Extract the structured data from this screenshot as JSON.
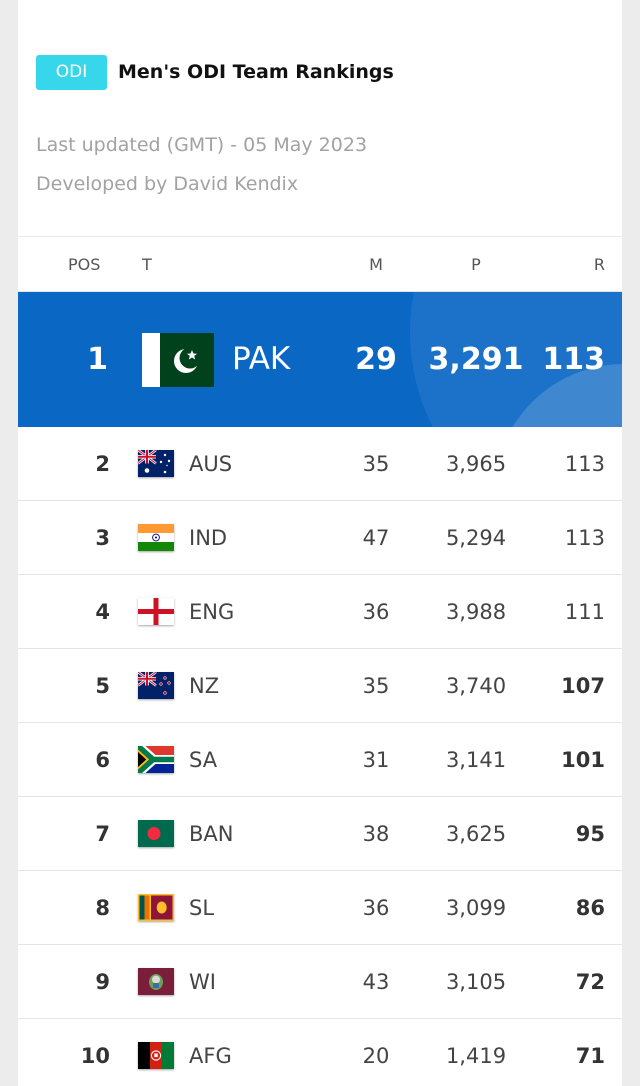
{
  "header": {
    "badge": "ODI",
    "title": "Men's ODI Team Rankings",
    "last_updated": "Last updated (GMT) - 05 May 2023",
    "developer": "Developed by David Kendix"
  },
  "columns": {
    "pos": "POS",
    "team": "T",
    "matches": "M",
    "points": "P",
    "rating": "R"
  },
  "rows": [
    {
      "pos": "1",
      "code": "PAK",
      "flag": "pakistan-flag-icon",
      "m": "29",
      "p": "3,291",
      "r": "113"
    },
    {
      "pos": "2",
      "code": "AUS",
      "flag": "australia-flag-icon",
      "m": "35",
      "p": "3,965",
      "r": "113"
    },
    {
      "pos": "3",
      "code": "IND",
      "flag": "india-flag-icon",
      "m": "47",
      "p": "5,294",
      "r": "113"
    },
    {
      "pos": "4",
      "code": "ENG",
      "flag": "england-flag-icon",
      "m": "36",
      "p": "3,988",
      "r": "111"
    },
    {
      "pos": "5",
      "code": "NZ",
      "flag": "new-zealand-flag-icon",
      "m": "35",
      "p": "3,740",
      "r": "107"
    },
    {
      "pos": "6",
      "code": "SA",
      "flag": "south-africa-flag-icon",
      "m": "31",
      "p": "3,141",
      "r": "101"
    },
    {
      "pos": "7",
      "code": "BAN",
      "flag": "bangladesh-flag-icon",
      "m": "38",
      "p": "3,625",
      "r": "95"
    },
    {
      "pos": "8",
      "code": "SL",
      "flag": "sri-lanka-flag-icon",
      "m": "36",
      "p": "3,099",
      "r": "86"
    },
    {
      "pos": "9",
      "code": "WI",
      "flag": "west-indies-flag-icon",
      "m": "43",
      "p": "3,105",
      "r": "72"
    },
    {
      "pos": "10",
      "code": "AFG",
      "flag": "afghanistan-flag-icon",
      "m": "20",
      "p": "1,419",
      "r": "71"
    }
  ],
  "colors": {
    "badge": "#36d7ea",
    "top_row": "#0a68c4",
    "muted_text": "#a2a2a2"
  }
}
